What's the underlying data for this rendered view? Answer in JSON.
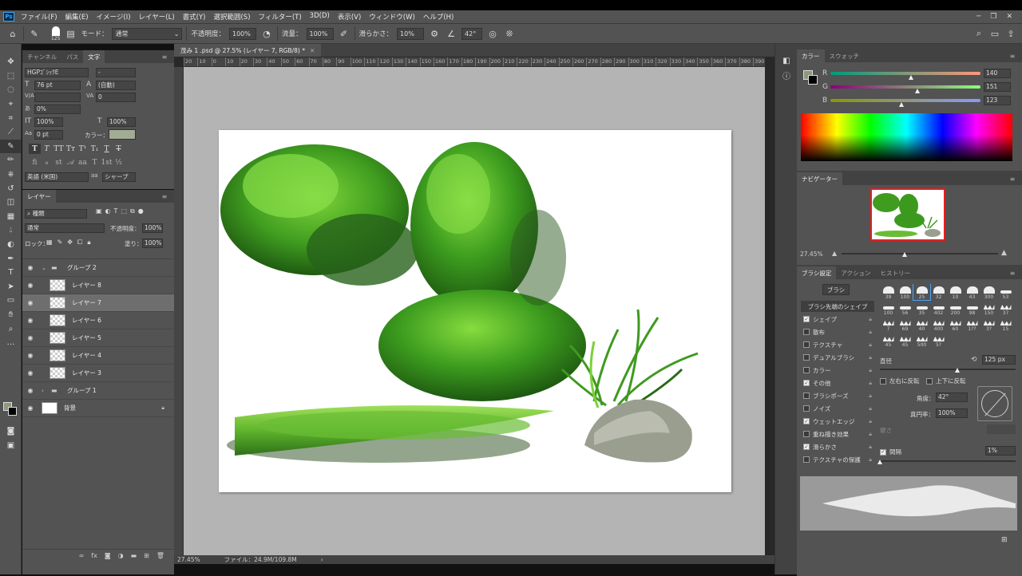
{
  "app": {
    "logo": "Ps"
  },
  "menu": [
    "ファイル(F)",
    "編集(E)",
    "イメージ(I)",
    "レイヤー(L)",
    "書式(Y)",
    "選択範囲(S)",
    "フィルター(T)",
    "3D(D)",
    "表示(V)",
    "ウィンドウ(W)",
    "ヘルプ(H)"
  ],
  "options": {
    "brush_size": "125",
    "mode_label": "モード：",
    "mode_value": "通常",
    "opacity_label": "不透明度：",
    "opacity_value": "100%",
    "flow_label": "流量：",
    "flow_value": "100%",
    "smoothing_label": "滑らかさ：",
    "smoothing_value": "10%",
    "angle_value": "42°"
  },
  "character_panel": {
    "tabs": [
      "チャンネル",
      "パス",
      "文字"
    ],
    "font_family": "HGPｺﾞｼｯｸE",
    "font_style": "-",
    "font_size": "76 pt",
    "leading": "(自動)",
    "kerning": "",
    "tracking": "0",
    "tsume": "0%",
    "vertical_scale": "100%",
    "horizontal_scale": "100%",
    "baseline": "0 pt",
    "color_label": "カラー：",
    "language": "英語 (米国)",
    "antialias": "シャープ",
    "color": "#a2ac94"
  },
  "layers_panel": {
    "title": "レイヤー",
    "filter_kind": "種類",
    "blend_mode": "通常",
    "opacity_label": "不透明度：",
    "opacity": "100%",
    "lock_label": "ロック：",
    "fill_label": "塗り：",
    "fill": "100%",
    "layers": [
      {
        "name": "グループ 2",
        "type": "group",
        "open": true
      },
      {
        "name": "レイヤー 8",
        "type": "layer"
      },
      {
        "name": "レイヤー 7",
        "type": "layer",
        "selected": true
      },
      {
        "name": "レイヤー 6",
        "type": "layer"
      },
      {
        "name": "レイヤー 5",
        "type": "layer"
      },
      {
        "name": "レイヤー 4",
        "type": "layer"
      },
      {
        "name": "レイヤー 3",
        "type": "layer"
      },
      {
        "name": "グループ 1",
        "type": "group",
        "open": false
      },
      {
        "name": "背景",
        "type": "background"
      }
    ]
  },
  "document": {
    "tab_title": "茂み 1 .psd @ 27.5% (レイヤー 7, RGB/8) *",
    "ruler_h": [
      "20",
      "10",
      "0",
      "10",
      "20",
      "30",
      "40",
      "50",
      "60",
      "70",
      "80",
      "90",
      "100",
      "110",
      "120",
      "130",
      "140",
      "150",
      "160",
      "170",
      "180",
      "190",
      "200",
      "210",
      "220",
      "230",
      "240",
      "250",
      "260",
      "270",
      "280",
      "290",
      "300",
      "310",
      "320",
      "330",
      "340",
      "350",
      "360",
      "370",
      "380",
      "390"
    ],
    "zoom": "27.45%",
    "file_info": "ファイル：24.9M/109.8M"
  },
  "color_panel": {
    "tabs": [
      "カラー",
      "スウォッチ"
    ],
    "r_label": "R",
    "r": "140",
    "g_label": "G",
    "g": "151",
    "b_label": "B",
    "b": "123",
    "foreground": "#8c977b"
  },
  "navigator": {
    "title": "ナビゲーター",
    "zoom": "27.45%"
  },
  "brush_settings": {
    "tabs": [
      "ブラシ設定",
      "アクション",
      "ヒストリー"
    ],
    "brush_button": "ブラシ",
    "tip_shape_label": "ブラシ先端のシェイプ",
    "options": [
      {
        "label": "シェイプ",
        "checked": true
      },
      {
        "label": "散布",
        "checked": false
      },
      {
        "label": "テクスチャ",
        "checked": false
      },
      {
        "label": "デュアルブラシ",
        "checked": false
      },
      {
        "label": "カラー",
        "checked": false
      },
      {
        "label": "その他",
        "checked": true
      },
      {
        "label": "ブラシポーズ",
        "checked": false
      },
      {
        "label": "ノイズ",
        "checked": false
      },
      {
        "label": "ウェットエッジ",
        "checked": true
      },
      {
        "label": "重ね描き効果",
        "checked": false
      },
      {
        "label": "滑らかさ",
        "checked": true
      },
      {
        "label": "テクスチャの保護",
        "checked": false
      }
    ],
    "tip_sizes": [
      "39",
      "100",
      "25",
      "32",
      "10",
      "43",
      "300",
      "53",
      "100",
      "56",
      "35",
      "402",
      "200",
      "98",
      "150",
      "37",
      "7",
      "69",
      "40",
      "400",
      "60",
      "1??",
      "3?",
      "15",
      "45",
      "45",
      "500",
      "5?"
    ],
    "diameter_label": "直径",
    "diameter": "125 px",
    "flip_x": "左右に反転",
    "flip_y": "上下に反転",
    "angle_label": "角度：",
    "angle": "42°",
    "roundness_label": "真円率：",
    "roundness": "100%",
    "hardness_label": "硬さ",
    "spacing_label": "間隔",
    "spacing": "1%"
  }
}
